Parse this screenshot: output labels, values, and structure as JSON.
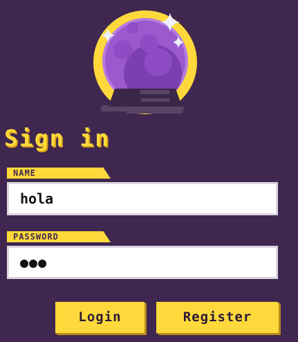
{
  "page": {
    "title": "Sign in"
  },
  "form": {
    "name_label": "NAME",
    "name_value": "hola",
    "password_label": "PASSWORD",
    "password_value": "●●●"
  },
  "buttons": {
    "login_label": "Login",
    "register_label": "Register"
  },
  "logo": {
    "icon": "crystal-ball-icon"
  },
  "colors": {
    "background": "#3f2750",
    "accent": "#ffd93b",
    "orb": "#9b59d0",
    "input_background": "#ffffff"
  }
}
